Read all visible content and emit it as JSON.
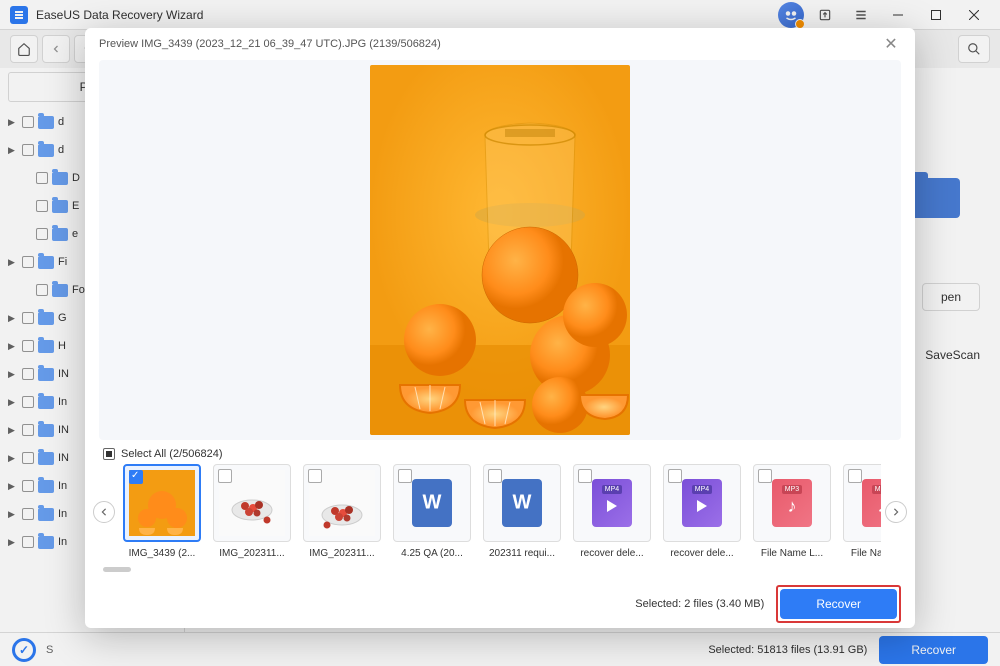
{
  "app": {
    "title": "EaseUS Data Recovery Wizard"
  },
  "toolbar": {
    "search_placeholder": "Search"
  },
  "sidebar": {
    "path_label": "Path",
    "items": [
      {
        "label": "d",
        "expandable": true,
        "indent": false
      },
      {
        "label": "d",
        "expandable": true,
        "indent": false
      },
      {
        "label": "D",
        "expandable": false,
        "indent": true
      },
      {
        "label": "E",
        "expandable": false,
        "indent": true
      },
      {
        "label": "e",
        "expandable": false,
        "indent": true
      },
      {
        "label": "Fi",
        "expandable": true,
        "indent": false
      },
      {
        "label": "Fo",
        "expandable": false,
        "indent": true
      },
      {
        "label": "G",
        "expandable": true,
        "indent": false
      },
      {
        "label": "H",
        "expandable": true,
        "indent": false
      },
      {
        "label": "IN",
        "expandable": true,
        "indent": false
      },
      {
        "label": "In",
        "expandable": true,
        "indent": false
      },
      {
        "label": "IN",
        "expandable": true,
        "indent": false
      },
      {
        "label": "IN",
        "expandable": true,
        "indent": false
      },
      {
        "label": "In",
        "expandable": true,
        "indent": false
      },
      {
        "label": "In",
        "expandable": true,
        "indent": false
      },
      {
        "label": "In",
        "expandable": true,
        "indent": false
      }
    ]
  },
  "right": {
    "open_label": "pen",
    "savescan_label": "SaveScan"
  },
  "bottombar": {
    "status_prefix": "S",
    "selected_text": "Selected: 51813 files (13.91 GB)",
    "recover_label": "Recover"
  },
  "modal": {
    "title": "Preview IMG_3439 (2023_12_21 06_39_47 UTC).JPG (2139/506824)",
    "selectall_label": "Select All (2/506824)",
    "thumbs": [
      {
        "label": "IMG_3439 (2...",
        "type": "oranges",
        "checked": true,
        "selected": true
      },
      {
        "label": "IMG_202311...",
        "type": "berries1",
        "checked": false,
        "selected": false
      },
      {
        "label": "IMG_202311...",
        "type": "berries2",
        "checked": false,
        "selected": false
      },
      {
        "label": "4.25 QA (20...",
        "type": "doc",
        "checked": false,
        "selected": false
      },
      {
        "label": "202311 requi...",
        "type": "doc",
        "checked": false,
        "selected": false
      },
      {
        "label": "recover dele...",
        "type": "mp4",
        "checked": false,
        "selected": false
      },
      {
        "label": "recover dele...",
        "type": "mp4",
        "checked": false,
        "selected": false
      },
      {
        "label": "File Name L...",
        "type": "mp3",
        "checked": false,
        "selected": false
      },
      {
        "label": "File Name L...",
        "type": "mp3",
        "checked": false,
        "selected": false
      }
    ],
    "footer_text": "Selected: 2 files (3.40 MB)",
    "recover_label": "Recover"
  }
}
